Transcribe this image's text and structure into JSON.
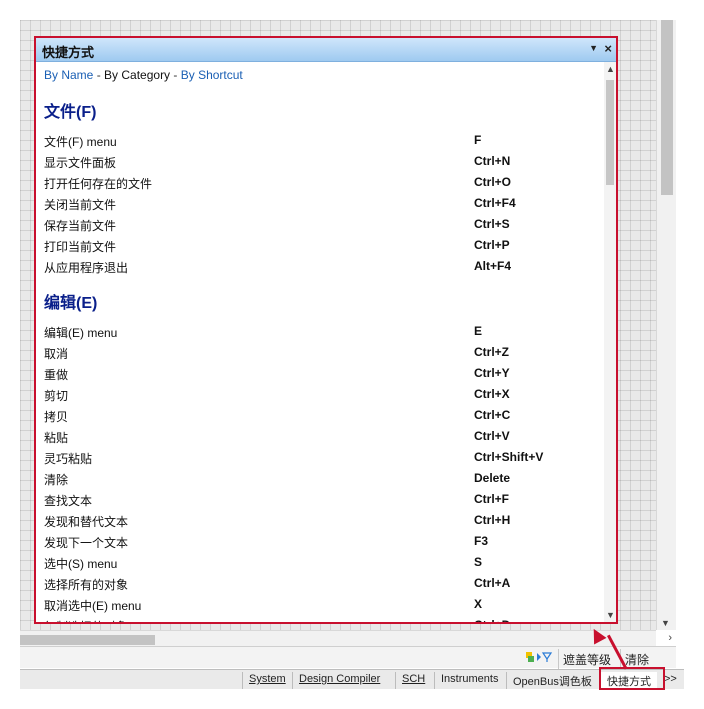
{
  "panel": {
    "title": "快捷方式",
    "menu_icon": "dropdown-triangle-icon",
    "close_icon": "close-icon"
  },
  "sort": {
    "by_name": "By Name",
    "by_category": "By Category",
    "by_shortcut": "By Shortcut",
    "separator": " - "
  },
  "sections": [
    {
      "title": "文件(F)",
      "rows": [
        {
          "name": "文件(F) menu",
          "key": "F"
        },
        {
          "name": "显示文件面板",
          "key": "Ctrl+N"
        },
        {
          "name": "打开任何存在的文件",
          "key": "Ctrl+O"
        },
        {
          "name": "关闭当前文件",
          "key": "Ctrl+F4"
        },
        {
          "name": "保存当前文件",
          "key": "Ctrl+S"
        },
        {
          "name": "打印当前文件",
          "key": "Ctrl+P"
        },
        {
          "name": "从应用程序退出",
          "key": "Alt+F4"
        }
      ]
    },
    {
      "title": "编辑(E)",
      "rows": [
        {
          "name": "编辑(E) menu",
          "key": "E"
        },
        {
          "name": "取消",
          "key": "Ctrl+Z"
        },
        {
          "name": "重做",
          "key": "Ctrl+Y"
        },
        {
          "name": "剪切",
          "key": "Ctrl+X"
        },
        {
          "name": "拷贝",
          "key": "Ctrl+C"
        },
        {
          "name": "粘贴",
          "key": "Ctrl+V"
        },
        {
          "name": "灵巧粘贴",
          "key": "Ctrl+Shift+V"
        },
        {
          "name": "清除",
          "key": "Delete"
        },
        {
          "name": "查找文本",
          "key": "Ctrl+F"
        },
        {
          "name": "发现和替代文本",
          "key": "Ctrl+H"
        },
        {
          "name": "发现下一个文本",
          "key": "F3"
        },
        {
          "name": "选中(S) menu",
          "key": "S"
        },
        {
          "name": "选择所有的对象",
          "key": "Ctrl+A"
        },
        {
          "name": "取消选中(E) menu",
          "key": "X"
        },
        {
          "name": "复制选择的对象",
          "key": "Ctrl+D"
        }
      ]
    }
  ],
  "status": {
    "mask_level": "遮盖等级",
    "clear": "清除"
  },
  "tabs": {
    "system": "System",
    "design_compiler": "Design Compiler",
    "sch": "SCH",
    "instruments": "Instruments",
    "openbus": "OpenBus调色板",
    "shortcuts": "快捷方式",
    "more": ">>"
  },
  "colors": {
    "highlight": "#c8102e",
    "title_bar": "#a8d0f2",
    "section_heading": "#0a1f8a",
    "link": "#1a5fb4"
  }
}
